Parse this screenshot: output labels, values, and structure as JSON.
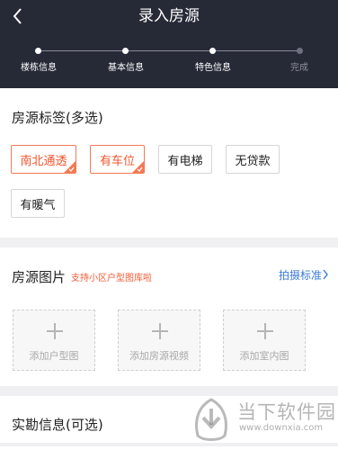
{
  "header": {
    "title": "录入房源",
    "steps": [
      {
        "label": "楼栋信息",
        "state": "done"
      },
      {
        "label": "基本信息",
        "state": "done"
      },
      {
        "label": "特色信息",
        "state": "current"
      },
      {
        "label": "完成",
        "state": "todo"
      }
    ]
  },
  "tags_section": {
    "title": "房源标签(多选)",
    "tags": [
      {
        "label": "南北通透",
        "selected": true
      },
      {
        "label": "有车位",
        "selected": true
      },
      {
        "label": "有电梯",
        "selected": false
      },
      {
        "label": "无贷款",
        "selected": false
      },
      {
        "label": "有暖气",
        "selected": false
      }
    ]
  },
  "photos_section": {
    "title": "房源图片",
    "hint": "支持小区户型图库啦",
    "standard_link": "拍摄标准",
    "uploads": [
      {
        "label": "添加户型图",
        "icon": "plus-icon"
      },
      {
        "label": "添加房源视频",
        "icon": "plus-icon"
      },
      {
        "label": "添加室内图",
        "icon": "plus-icon"
      }
    ]
  },
  "survey_section": {
    "title": "实勘信息(可选)"
  },
  "watermark": {
    "name": "当下软件园",
    "url": "www.downxia.com"
  },
  "colors": {
    "header_bg": "#262936",
    "accent": "#f0562e",
    "link": "#3a7bd5"
  }
}
